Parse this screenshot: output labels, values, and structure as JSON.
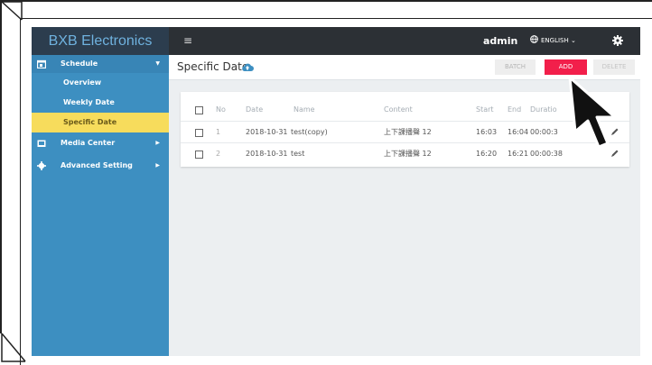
{
  "brand": "BXB Electronics",
  "sidebar": {
    "schedule": {
      "label": "Schedule",
      "arrow": "▼"
    },
    "items": [
      {
        "label": "Overview"
      },
      {
        "label": "Weekly Date"
      },
      {
        "label": "Specific Date"
      }
    ],
    "media_center": {
      "label": "Media Center",
      "arrow": "▶"
    },
    "advanced": {
      "label": "Advanced Setting",
      "arrow": "▶"
    }
  },
  "topbar": {
    "menu": "≡",
    "user": "admin",
    "language": "ENGLISH ⌄"
  },
  "page": {
    "title": "Specific Date"
  },
  "toolbar": {
    "batch": "BATCH",
    "add": "ADD",
    "delete": "DELETE"
  },
  "table": {
    "headers": {
      "no": "No",
      "date": "Date",
      "name": "Name",
      "content": "Content",
      "start": "Start",
      "end": "End",
      "duration": "Duratio"
    },
    "rows": [
      {
        "no": "1",
        "date": "2018-10-31",
        "name": "test(copy)",
        "content": "上下課播聲 12",
        "start": "16:03",
        "end": "16:04",
        "duration": "00:00:3"
      },
      {
        "no": "2",
        "date": "2018-10-31",
        "name": "test",
        "content": "上下課播聲 12",
        "start": "16:20",
        "end": "16:21",
        "duration": "00:00:38"
      }
    ]
  },
  "colors": {
    "sidebar": "#3d8fc1",
    "brand_bg": "#2c3d4e",
    "topbar": "#2c3035",
    "active": "#f7dc5c",
    "add": "#f21f4b",
    "content_bg": "#eceff1"
  },
  "icons": [
    "calendar-icon",
    "media-icon",
    "gear-icon",
    "globe-icon",
    "cloud-upload-icon",
    "edit-pencil-icon",
    "menu-icon",
    "cursor-arrow-icon"
  ]
}
